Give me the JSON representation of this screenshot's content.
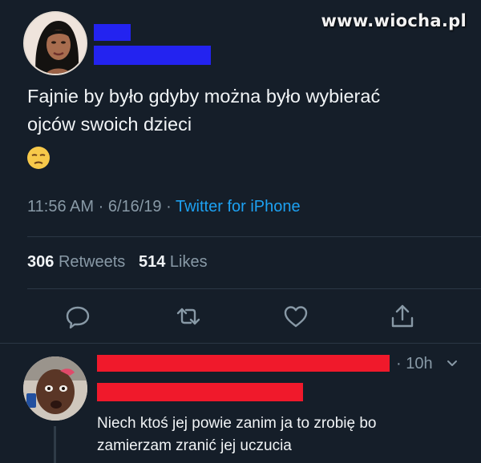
{
  "watermark": "www.wiocha.pl",
  "tweet": {
    "text_line1": "Fajnie by było gdyby można było wybierać",
    "text_line2": "ojców swoich dzieci",
    "emoji": "unamused-face-emoji",
    "time": "11:56 AM",
    "date": "6/16/19",
    "separator": "·",
    "source": "Twitter for iPhone",
    "retweets_count": "306",
    "retweets_label": "Retweets",
    "likes_count": "514",
    "likes_label": "Likes"
  },
  "actions": [
    {
      "name": "reply-icon"
    },
    {
      "name": "retweet-icon"
    },
    {
      "name": "like-icon"
    },
    {
      "name": "share-icon"
    }
  ],
  "reply": {
    "time": "· 10h",
    "text_line1": "Niech ktoś jej powie zanim ja to zrobię bo",
    "text_line2": "zamierzam zranić jej uczucia"
  },
  "colors": {
    "background": "#151e29",
    "text": "#f1f4f6",
    "muted": "#8899a6",
    "link": "#1da1f2",
    "blue_redaction": "#2323f0",
    "red_redaction": "#f0192b"
  }
}
